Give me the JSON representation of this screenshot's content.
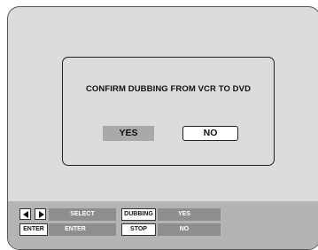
{
  "dialog": {
    "message": "CONFIRM DUBBING FROM VCR TO DVD",
    "yes_label": "YES",
    "no_label": "NO",
    "selected": "YES"
  },
  "help": {
    "select_icons": [
      "left-arrow-icon",
      "right-arrow-icon"
    ],
    "select_label": "SELECT",
    "enter_key": "ENTER",
    "enter_label": "ENTER",
    "dubbing_key": "DUBBING",
    "dubbing_label": "YES",
    "stop_key": "STOP",
    "stop_label": "NO"
  },
  "colors": {
    "screen_bg": "#dcdcdc",
    "highlight": "#a9a9a9",
    "helpbar_bg": "#b4b4b4",
    "helpbar_dark": "#8e8e8e"
  }
}
